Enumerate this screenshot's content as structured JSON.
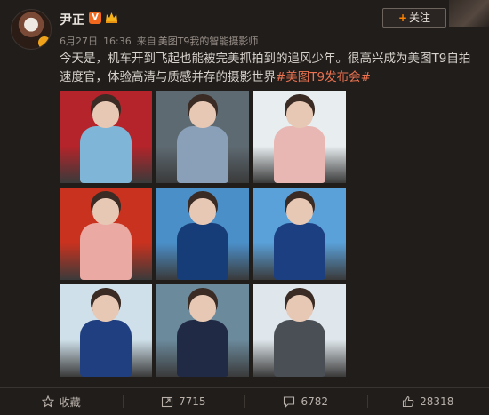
{
  "user": {
    "name": "尹正",
    "verified_badge": "V",
    "follow_label": "关注",
    "follow_plus": "+"
  },
  "post": {
    "date": "6月27日",
    "time": "16:36",
    "source_prefix": "来自",
    "source": "美图T9我的智能摄影师",
    "text_main": "今天是，机车开到飞起也能被完美抓拍到的追风少年。很高兴成为美图T9自拍速度官，体验高清与质感并存的摄影世界",
    "hashtag": "#美图T9发布会#"
  },
  "photos": [
    {
      "name": "photo-red-sofa",
      "bg": "#b4242a",
      "body": "#7fb6d8"
    },
    {
      "name": "photo-studio-desk",
      "bg": "#5e6a72",
      "body": "#8aa0b8"
    },
    {
      "name": "photo-white-wall",
      "bg": "#e8eef0",
      "body": "#e9b7b3"
    },
    {
      "name": "photo-red-backdrop",
      "bg": "#c9321f",
      "body": "#eaa9a2"
    },
    {
      "name": "photo-motorcycle-dome",
      "bg": "#4b8fc9",
      "body": "#173d78"
    },
    {
      "name": "photo-motorcycle-track",
      "bg": "#5aa0d9",
      "body": "#1c3f82"
    },
    {
      "name": "photo-racing-suit-camera",
      "bg": "#cfe0ea",
      "body": "#1f3f80"
    },
    {
      "name": "photo-leaning-rider",
      "bg": "#6b8a9c",
      "body": "#202a44"
    },
    {
      "name": "photo-phone-shot",
      "bg": "#dfe7ec",
      "body": "#4a4f56"
    }
  ],
  "actions": {
    "favorite_label": "收藏",
    "repost_count": "7715",
    "comment_count": "6782",
    "like_count": "28318"
  },
  "colors": {
    "background": "#211d1b",
    "hashtag": "#eb7350",
    "follow_plus": "#ff8200"
  }
}
